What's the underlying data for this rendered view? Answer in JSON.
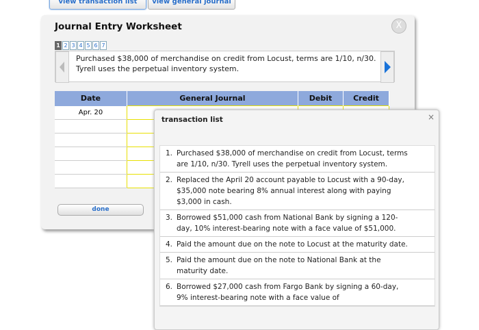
{
  "top_buttons": {
    "transaction_list": "view transaction list",
    "general_journal": "view general journal"
  },
  "worksheet": {
    "title": "Journal Entry Worksheet",
    "close": "X",
    "pages": [
      "1",
      "2",
      "3",
      "4",
      "5",
      "6",
      "7"
    ],
    "description": "Purchased $38,000 of merchandise on credit from Locust, terms are 1/10, n/30. Tyrell uses the perpetual inventory system.",
    "columns": [
      "Date",
      "General Journal",
      "Debit",
      "Credit"
    ],
    "rows": [
      {
        "date": "Apr. 20"
      },
      {
        "date": ""
      },
      {
        "date": ""
      },
      {
        "date": ""
      },
      {
        "date": ""
      },
      {
        "date": ""
      }
    ],
    "done": "done"
  },
  "transaction_list": {
    "title": "transaction list",
    "close": "×",
    "items": [
      {
        "num": "1.",
        "text": "Purchased $38,000 of merchandise on credit from Locust, terms are 1/10, n/30. Tyrell uses the perpetual inventory system."
      },
      {
        "num": "2.",
        "text": "Replaced the April 20 account payable to Locust with a 90-day, $35,000 note bearing 8% annual interest along with paying $3,000 in cash."
      },
      {
        "num": "3.",
        "text": "Borrowed $51,000 cash from National Bank by signing a 120-day, 10% interest-bearing note with a face value of $51,000."
      },
      {
        "num": "4.",
        "text": "Paid the amount due on the note to Locust at the maturity date."
      },
      {
        "num": "5.",
        "text": "Paid the amount due on the note to National Bank at the maturity date."
      },
      {
        "num": "6.",
        "text": "Borrowed $27,000 cash from Fargo Bank by signing a 60-day, 9% interest-bearing note with a face value of"
      }
    ]
  }
}
